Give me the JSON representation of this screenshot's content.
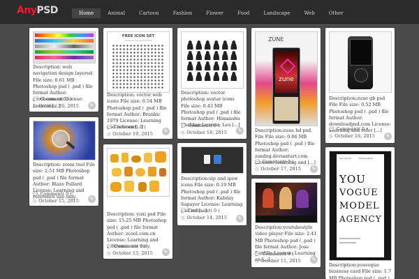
{
  "logo": {
    "part1": "Any",
    "part2": "PSD"
  },
  "nav": [
    "Home",
    "Animal",
    "Cartoon",
    "Fashion",
    "Flower",
    "Food",
    "Landscape",
    "Web",
    "Other"
  ],
  "cards": [
    {
      "desc": "Description: web navigation design layered File size: 0.61 MB Photoshop psd ( .psd ) file format Author: zcool.com.cn License: Learnin [...]",
      "comments": "Comment( 0 )",
      "date": "October 20, 2015"
    },
    {
      "desc": "Description: zoom tool File size: 2.51 MB Photoshop psd ( .psd ) file format Author: Blaze Pollard License: Learning and reference use only.",
      "comments": "Comment( 0 )",
      "date": "October 15, 2015"
    },
    {
      "thumb_title": "FREE ICON SET",
      "thumb_sub": "Designed by Brankic1979",
      "desc": "Description: vector web icons File size: 0.54 MB Photoshop psd ( .psd ) file format Author: Brankic 1979 License: Learning and referen [...]",
      "comments": "Comment( 0 )",
      "date": "October 19, 2015"
    },
    {
      "desc": "Description: yuxi psd File size: 15.25 MB Photoshop psd ( .psd ) file format Author: zcool.com.cn License: Learning and reference use only.",
      "comments": "Comment( 0 )",
      "date": "October 13, 2015"
    },
    {
      "desc": "Description: vector photoshop avatar icons File size: 0.43 MB Photoshop psd ( .psd ) file format Author: Himanshu Shakhar License: Lea [...]",
      "comments": "Comment( 0 )",
      "date": "October 18, 2015"
    },
    {
      "desc": "Description:zip and ipsw icons File size: 0.19 MB Photoshop psd ( .psd ) file format Author: Kabilay Sapayer License: Learning and ref [...]",
      "comments": "Comment( 0 )",
      "date": "October 14, 2015"
    },
    {
      "thumb_text": "zune",
      "thumb_small": "ZUNE",
      "desc": "Description:zune hd psd File File size: 0.86 MB Photoshop psd ( .psd ) file format Author: zandog.deviantart.com License: Learning and [...]",
      "comments": "Comment( 0 )",
      "date": "October 17, 2015"
    },
    {
      "desc": "Description:youtubestyle video player File size: 2.41 MB Photoshop psd ( .psd ) file format Author: Jose Pardilla License: Learning an [...]",
      "comments": "Comment( 0 )",
      "date": "October 11, 2015"
    },
    {
      "desc": "Description:zune gb psd File File size: 0.52 MB Photoshop psd ( .psd ) file format Author: downloadpsd.com License: Learning and refer [...]",
      "comments": "Comment( 0 )",
      "date": "October 16, 2015"
    },
    {
      "thumb_lines": [
        "YOU",
        "VOGUE",
        "MODEL",
        "AGENCY"
      ],
      "thumb_top_left": "Get Overall",
      "thumb_top_right": "Photographer",
      "desc": "Description:youvogue business card File size: 1.7 MB Photoshop psd ( .psd ) file format Author"
    }
  ],
  "colors": {
    "accent": "#e8202a",
    "background": "#4a4a4a",
    "topbar": "#2b2b2b"
  }
}
